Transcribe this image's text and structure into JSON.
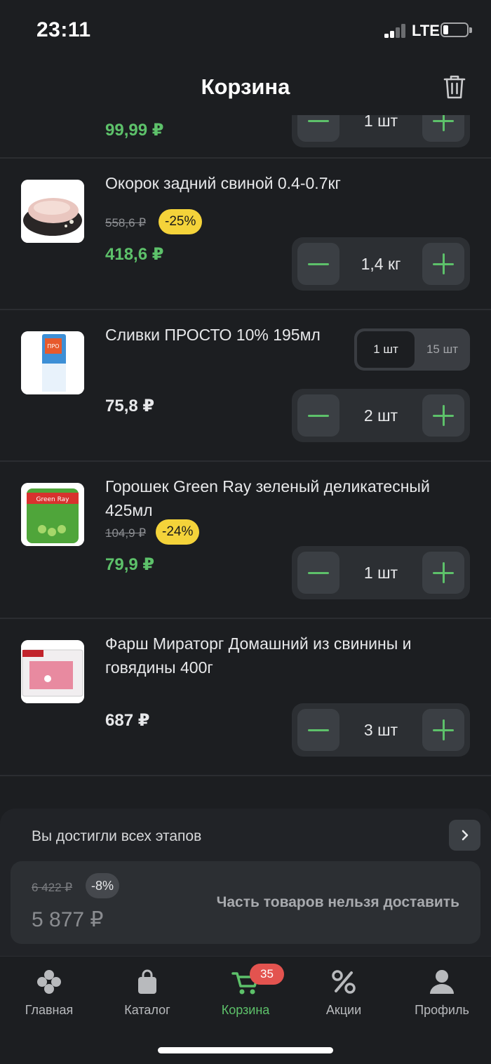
{
  "status_bar": {
    "time": "23:11",
    "network": "LTE"
  },
  "header": {
    "title": "Корзина"
  },
  "items": [
    {
      "name": "",
      "price": "99,99 ₽",
      "price_color": "#5dc16a",
      "quantity": "1 шт"
    },
    {
      "name": "Окорок задний свиной 0.4-0.7кг",
      "old_price": "558,6 ₽",
      "discount": "-25%",
      "price": "418,6 ₽",
      "price_color": "#5dc16a",
      "quantity": "1,4 кг"
    },
    {
      "name": "Сливки ПРОСТО 10% 195мл",
      "unit_options": [
        "1 шт",
        "15 шт"
      ],
      "unit_selected": "1 шт",
      "price": "75,8 ₽",
      "quantity": "2 шт"
    },
    {
      "name": "Горошек Green Ray зеленый деликатесный 425мл",
      "old_price": "104,9 ₽",
      "discount": "-24%",
      "price": "79,9 ₽",
      "price_color": "#5dc16a",
      "quantity": "1 шт"
    },
    {
      "name": "Фарш Мираторг Домашний из свинины и говядины 400г",
      "price": "687 ₽",
      "quantity": "3 шт"
    }
  ],
  "summary": {
    "stages_text": "Вы достигли всех этапов",
    "old_total": "6 422 ₽",
    "discount": "-8%",
    "total": "5 877 ₽",
    "note": "Часть товаров нельзя доставить"
  },
  "tabs": [
    {
      "label": "Главная",
      "icon": "home-icon"
    },
    {
      "label": "Каталог",
      "icon": "catalog-bag-icon"
    },
    {
      "label": "Корзина",
      "icon": "cart-icon",
      "badge": "35",
      "active": true
    },
    {
      "label": "Акции",
      "icon": "percent-icon"
    },
    {
      "label": "Профиль",
      "icon": "profile-icon"
    }
  ],
  "colors": {
    "accent": "#5dc16a",
    "discount_badge": "#f4d33a",
    "cart_badge": "#e3534f",
    "background": "#1c1e21"
  }
}
